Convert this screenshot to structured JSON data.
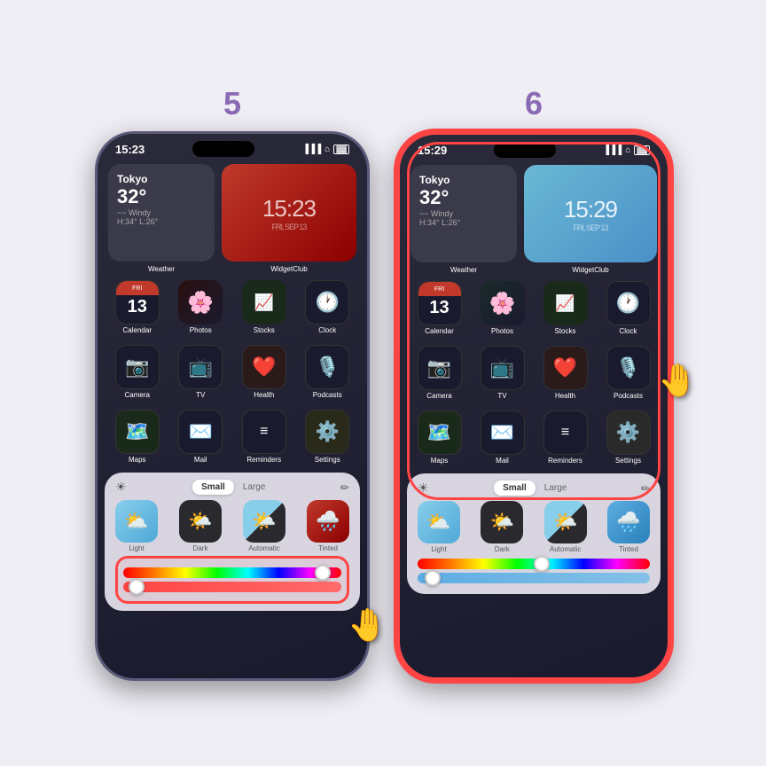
{
  "sections": [
    {
      "number": "5",
      "phone": {
        "time": "15:23",
        "signal": "▐▐▐",
        "wifi": "WiFi",
        "battery": "🔋",
        "highlighted": false,
        "highlight_area": "sliders",
        "widgets": {
          "weather": {
            "city": "Tokyo",
            "temp": "32°",
            "condition": "Windy",
            "info": "H:34° L:26°"
          },
          "clock_time": "15:23",
          "clock_date": "FRI, SEP 13",
          "weather_label": "Weather",
          "clock_label": "WidgetClub",
          "theme": "red"
        },
        "apps_row1": [
          {
            "label": "Calendar",
            "icon": "📅",
            "day": "FRI 13"
          },
          {
            "label": "Photos",
            "icon": "🌸"
          },
          {
            "label": "Stocks",
            "icon": "📈"
          },
          {
            "label": "Clock",
            "icon": "🕐"
          }
        ],
        "apps_row2": [
          {
            "label": "Camera",
            "icon": "📷"
          },
          {
            "label": "TV",
            "icon": "📺"
          },
          {
            "label": "Health",
            "icon": "❤️"
          },
          {
            "label": "Podcasts",
            "icon": "🎙️"
          }
        ],
        "apps_row3": [
          {
            "label": "Maps",
            "icon": "🗺️"
          },
          {
            "label": "Mail",
            "icon": "✉️"
          },
          {
            "label": "Reminders",
            "icon": "≡"
          },
          {
            "label": "Settings",
            "icon": "⚙️"
          }
        ],
        "panel": {
          "size_active": "Small",
          "size_inactive": "Large",
          "variants": [
            {
              "type": "light",
              "label": "Light"
            },
            {
              "type": "dark",
              "label": "Dark"
            },
            {
              "type": "auto",
              "label": "Automatic"
            },
            {
              "type": "tinted-red",
              "label": "Tinted"
            }
          ]
        }
      }
    },
    {
      "number": "6",
      "phone": {
        "time": "15:29",
        "highlighted": true,
        "highlight_area": "screen",
        "widgets": {
          "weather": {
            "city": "Tokyo",
            "temp": "32°",
            "condition": "Windy",
            "info": "H:34° L:26°"
          },
          "clock_time": "15:29",
          "clock_date": "FRI, SEP 13",
          "weather_label": "Weather",
          "clock_label": "WidgetClub",
          "theme": "blue"
        },
        "panel": {
          "size_active": "Small",
          "size_inactive": "Large",
          "variants": [
            {
              "type": "light",
              "label": "Light"
            },
            {
              "type": "dark",
              "label": "Dark"
            },
            {
              "type": "auto",
              "label": "Automatic"
            },
            {
              "type": "tinted-blue",
              "label": "Tinted"
            }
          ]
        }
      }
    }
  ],
  "labels": {
    "light": "Light",
    "dark": "Dark",
    "automatic": "Automatic",
    "tinted": "Tinted",
    "small": "Small",
    "large": "Large",
    "weather": "Weather",
    "widgetclub": "WidgetClub",
    "clock": "Clock",
    "health": "Health"
  }
}
